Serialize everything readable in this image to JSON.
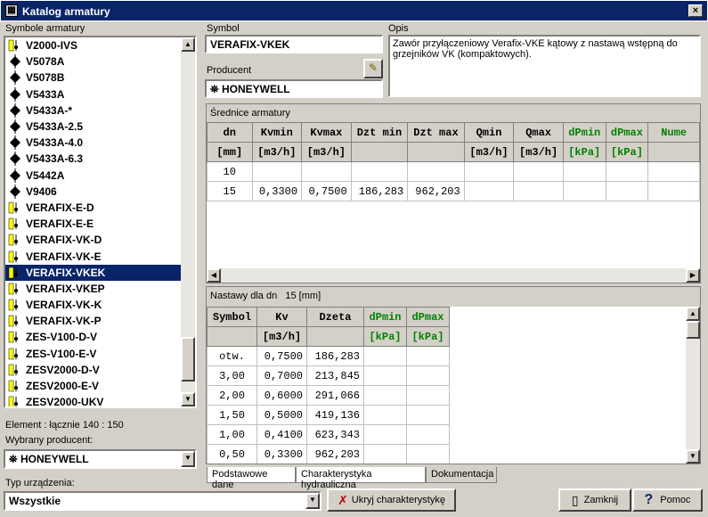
{
  "window": {
    "title": "Katalog armatury",
    "close_label": "×"
  },
  "left": {
    "list_label": "Symbole armatury",
    "items": [
      "V2000-IVS",
      "V5078A",
      "V5078B",
      "V5433A",
      "V5433A-*",
      "V5433A-2.5",
      "V5433A-4.0",
      "V5433A-6.3",
      "V5442A",
      "V9406",
      "VERAFIX-E-D",
      "VERAFIX-E-E",
      "VERAFIX-VK-D",
      "VERAFIX-VK-E",
      "VERAFIX-VKEK",
      "VERAFIX-VKEP",
      "VERAFIX-VK-K",
      "VERAFIX-VK-P",
      "ZES-V100-D-V",
      "ZES-V100-E-V",
      "ZESV2000-D-V",
      "ZESV2000-E-V",
      "ZESV2000-UKV"
    ],
    "selected_index": 14,
    "element_count": "Element : łącznie  140 : 150",
    "producer_label": "Wybrany producent:",
    "producer_value": "HONEYWELL",
    "type_label": "Typ urządzenia:",
    "type_value": "Wszystkie"
  },
  "symbol": {
    "label": "Symbol",
    "value": "VERAFIX-VKEK"
  },
  "producer": {
    "label": "Producent",
    "value": "HONEYWELL"
  },
  "opis": {
    "label": "Opis",
    "value": "Zawór przyłączeniowy Verafix-VKE kątowy z nastawą wstępną do grzejników VK (kompaktowych)."
  },
  "diam": {
    "label": "Średnice armatury",
    "headers": [
      "dn",
      "Kvmin",
      "Kvmax",
      "Dzt min",
      "Dzt max",
      "Qmin",
      "Qmax",
      "dPmin",
      "dPmax",
      "Nume"
    ],
    "units": [
      "[mm]",
      "[m3/h]",
      "[m3/h]",
      "",
      "",
      "[m3/h]",
      "[m3/h]",
      "[kPa]",
      "[kPa]",
      ""
    ],
    "rows": [
      [
        "10",
        "",
        "",
        "",
        "",
        "",
        "",
        "",
        "",
        ""
      ],
      [
        "15",
        "0,3300",
        "0,7500",
        "186,283",
        "962,203",
        "",
        "",
        "",
        "",
        ""
      ]
    ]
  },
  "nast": {
    "label": "Nastawy dla dn",
    "dn": "15 [mm]",
    "headers": [
      "Symbol",
      "Kv",
      "Dzeta",
      "dPmin",
      "dPmax"
    ],
    "units": [
      "",
      "[m3/h]",
      "",
      "[kPa]",
      "[kPa]"
    ],
    "rows": [
      [
        "otw.",
        "0,7500",
        "186,283"
      ],
      [
        "3,00",
        "0,7000",
        "213,845"
      ],
      [
        "2,00",
        "0,6000",
        "291,066"
      ],
      [
        "1,50",
        "0,5000",
        "419,136"
      ],
      [
        "1,00",
        "0,4100",
        "623,343"
      ],
      [
        "0,50",
        "0,3300",
        "962,203"
      ]
    ]
  },
  "tabs": [
    "Podstawowe dane",
    "Charakterystyka hydrauliczna",
    "Dokumentacja"
  ],
  "buttons": {
    "hide_chart": "Ukryj charakterystykę",
    "close": "Zamknij",
    "help": "Pomoc"
  }
}
